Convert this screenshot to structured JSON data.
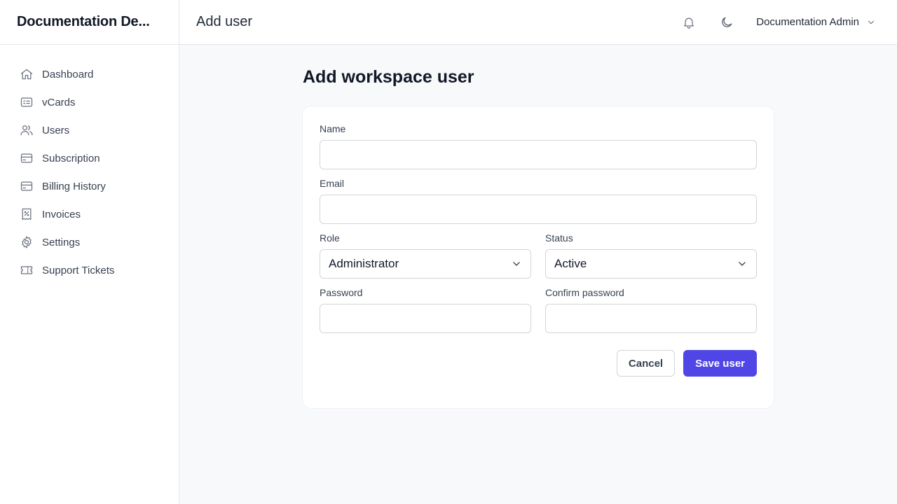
{
  "app": {
    "brand": "Documentation De..."
  },
  "header": {
    "title": "Add user",
    "user_name": "Documentation Admin"
  },
  "sidebar": {
    "items": [
      {
        "label": "Dashboard",
        "icon": "home-icon"
      },
      {
        "label": "vCards",
        "icon": "id-card-icon"
      },
      {
        "label": "Users",
        "icon": "users-icon"
      },
      {
        "label": "Subscription",
        "icon": "credit-card-icon"
      },
      {
        "label": "Billing History",
        "icon": "credit-card-icon"
      },
      {
        "label": "Invoices",
        "icon": "receipt-icon"
      },
      {
        "label": "Settings",
        "icon": "gear-icon"
      },
      {
        "label": "Support Tickets",
        "icon": "ticket-icon"
      }
    ]
  },
  "page": {
    "title": "Add workspace user"
  },
  "form": {
    "name": {
      "label": "Name",
      "value": ""
    },
    "email": {
      "label": "Email",
      "value": ""
    },
    "role": {
      "label": "Role",
      "value": "Administrator"
    },
    "status": {
      "label": "Status",
      "value": "Active"
    },
    "password": {
      "label": "Password",
      "value": ""
    },
    "confirm_password": {
      "label": "Confirm password",
      "value": ""
    },
    "cancel_label": "Cancel",
    "save_label": "Save user"
  },
  "colors": {
    "primary": "#4f46e5",
    "icon_gray": "#6b7280",
    "border": "#e5e7eb"
  }
}
